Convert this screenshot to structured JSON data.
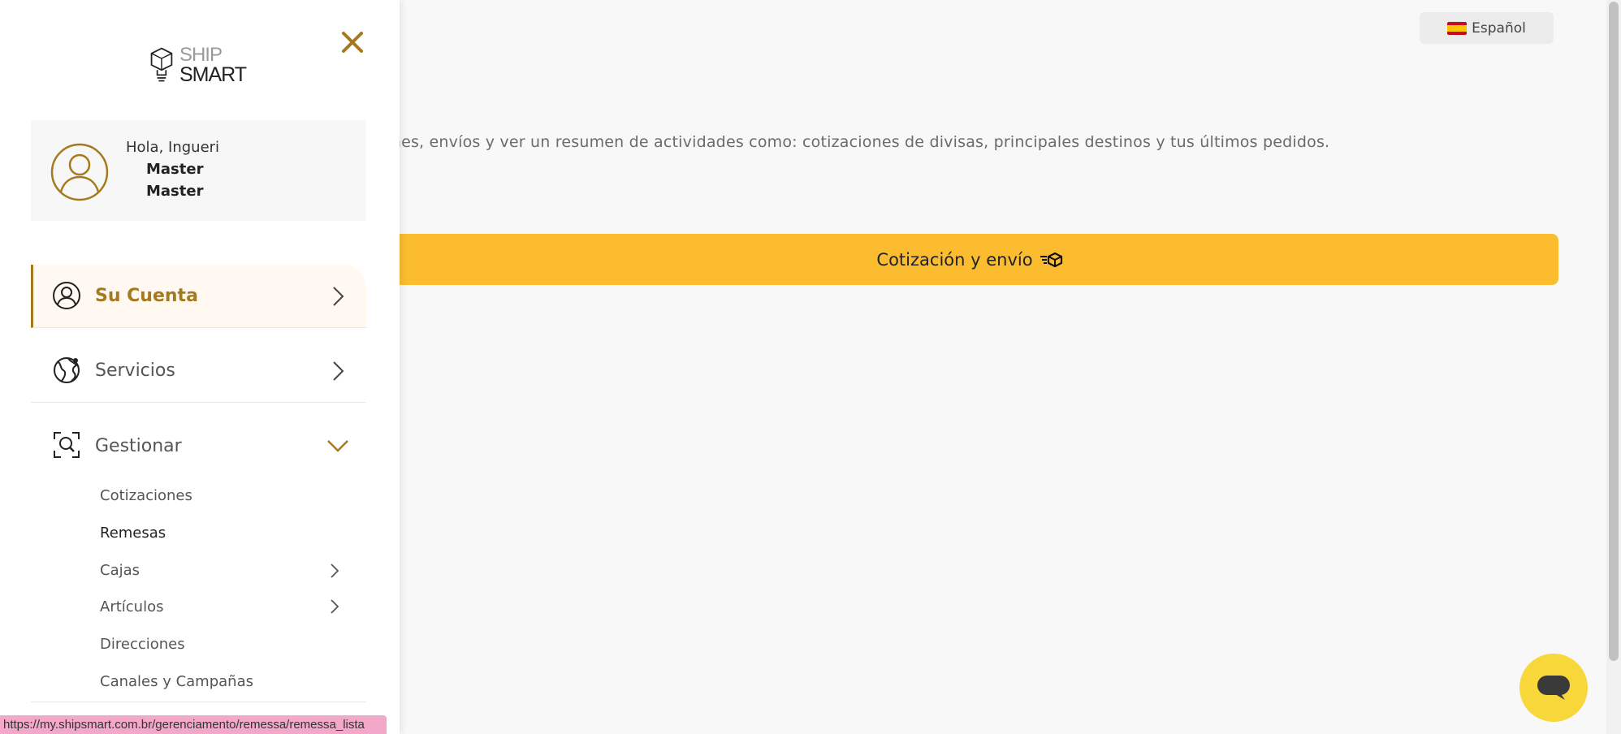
{
  "language": {
    "label": "Español"
  },
  "main": {
    "intro_text": "ones, envíos y ver un resumen de actividades como: cotizaciones de divisas, principales destinos y tus últimos pedidos.",
    "quote_button": "Cotización y envío"
  },
  "sidebar": {
    "logo": {
      "line1": "SHIP",
      "line2": "SMART"
    },
    "user": {
      "greeting": "Hola, Ingueri",
      "first_name": "Master",
      "last_name": "Master"
    },
    "nav": {
      "account": "Su Cuenta",
      "services": "Servicios",
      "manage": "Gestionar"
    },
    "submenu": {
      "quotes": "Cotizaciones",
      "remittances": "Remesas",
      "boxes": "Cajas",
      "articles": "Artículos",
      "addresses": "Direcciones",
      "channels": "Canales y Campañas"
    }
  },
  "status_bar": {
    "url": "https://my.shipsmart.com.br/gerenciamento/remessa/remessa_lista"
  },
  "colors": {
    "accent_gold": "#a57a1e",
    "primary_yellow": "#fbbd2f",
    "chat_yellow": "#f8d73a",
    "status_pink": "#f3a7c9"
  },
  "icons": {
    "logo": "lightbulb-box-icon",
    "close": "close-icon",
    "avatar": "user-circle-icon",
    "account": "user-circle-icon",
    "services": "globe-icon",
    "manage": "search-scan-icon",
    "chevron_right": "chevron-right-icon",
    "chevron_down": "chevron-down-icon",
    "quote": "fast-box-icon",
    "chat": "chat-bubble-icon"
  }
}
